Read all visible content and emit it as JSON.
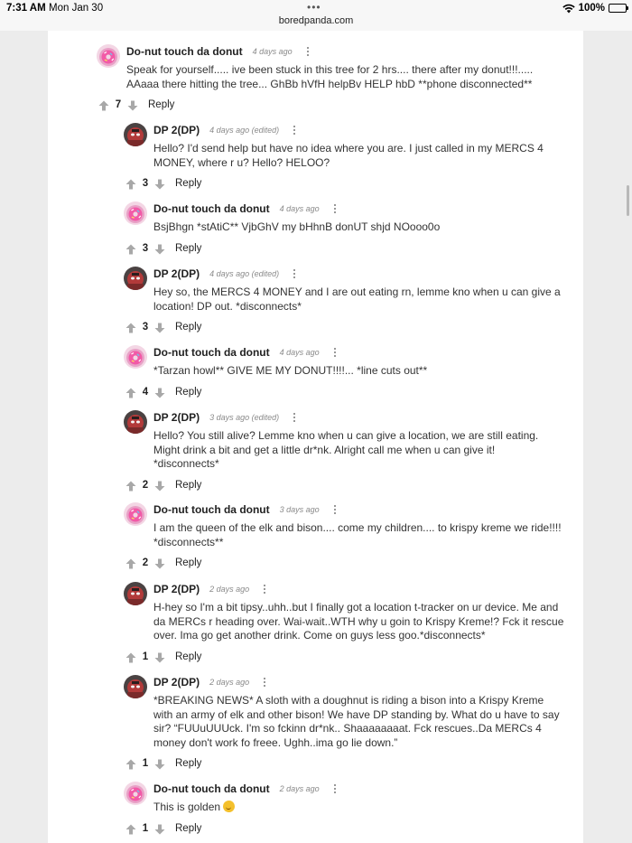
{
  "status_bar": {
    "time": "7:31 AM",
    "date": "Mon Jan 30",
    "url": "boredpanda.com",
    "battery": "100%"
  },
  "comments": [
    {
      "author": "Do-nut touch da donut",
      "meta": "4 days ago",
      "avatar": "donut-avatar",
      "lines": [
        "Speak for yourself..... ive been stuck in this tree for 2 hrs.... there after my donut!!!.....",
        "AAaaa there hitting the tree... GhBb hVfH helpBv HELP hbD **phone disconnected**"
      ],
      "votes": "7",
      "reply": "Reply"
    },
    {
      "author": "DP 2(DP)",
      "meta": "4 days ago (edited)",
      "avatar": "dp-avatar",
      "lines": [
        "Hello? I'd send help but have no idea where you are. I just called in my MERCS 4",
        "MONEY, where r u? Hello? HELOO?"
      ],
      "votes": "3",
      "reply": "Reply"
    },
    {
      "author": "Do-nut touch da donut",
      "meta": "4 days ago",
      "avatar": "donut-avatar",
      "lines": [
        "BsjBhgn *stAtiC** VjbGhV my bHhnB donUT shjd NOooo0o"
      ],
      "votes": "3",
      "reply": "Reply"
    },
    {
      "author": "DP 2(DP)",
      "meta": "4 days ago (edited)",
      "avatar": "dp-avatar",
      "lines": [
        "Hey so, the MERCS 4 MONEY and I are out eating rn, lemme kno when u can give a",
        "location! DP out. *disconnects*"
      ],
      "votes": "3",
      "reply": "Reply"
    },
    {
      "author": "Do-nut touch da donut",
      "meta": "4 days ago",
      "avatar": "donut-avatar",
      "lines": [
        "*Tarzan howl** GIVE ME MY DONUT!!!!... *line cuts out**"
      ],
      "votes": "4",
      "reply": "Reply"
    },
    {
      "author": "DP 2(DP)",
      "meta": "3 days ago (edited)",
      "avatar": "dp-avatar",
      "lines": [
        "Hello? You still alive? Lemme kno when u can give a location, we are still eating.",
        "Might drink a bit and get a little dr*nk. Alright call me when u can give it!",
        "*disconnects*"
      ],
      "votes": "2",
      "reply": "Reply"
    },
    {
      "author": "Do-nut touch da donut",
      "meta": "3 days ago",
      "avatar": "donut-avatar",
      "lines": [
        "I am the queen of the elk and bison.... come my children.... to krispy kreme we ride!!!!",
        "*disconnects**"
      ],
      "votes": "2",
      "reply": "Reply"
    },
    {
      "author": "DP 2(DP)",
      "meta": "2 days ago",
      "avatar": "dp-avatar",
      "lines": [
        "H-hey so I'm a bit tipsy..uhh..but I finally got a location t-tracker on ur device. Me and",
        "da MERCs r heading over. Wai-wait..WTH why u goin to Krispy Kreme!? Fck it rescue",
        "over. Ima go get another drink. Come on guys less goo.*disconnects*"
      ],
      "votes": "1",
      "reply": "Reply"
    },
    {
      "author": "DP 2(DP)",
      "meta": "2 days ago",
      "avatar": "dp-avatar",
      "lines": [
        "*BREAKING NEWS* A sloth with a doughnut is riding a bison into a Krispy Kreme",
        "with an army of elk and other bison! We have DP standing by. What do u have to say",
        "sir? “FUUuUUUck. I'm so fckinn dr*nk.. Shaaaaaaaat. Fck rescues..Da MERCs 4",
        "money don't work fo freee. Ughh..ima go lie down.”"
      ],
      "votes": "1",
      "reply": "Reply"
    },
    {
      "author": "Do-nut touch da donut",
      "meta": "2 days ago",
      "avatar": "donut-avatar",
      "lines": [
        "This is golden"
      ],
      "emoji": "thinking-emoji",
      "votes": "1",
      "reply": "Reply"
    }
  ]
}
